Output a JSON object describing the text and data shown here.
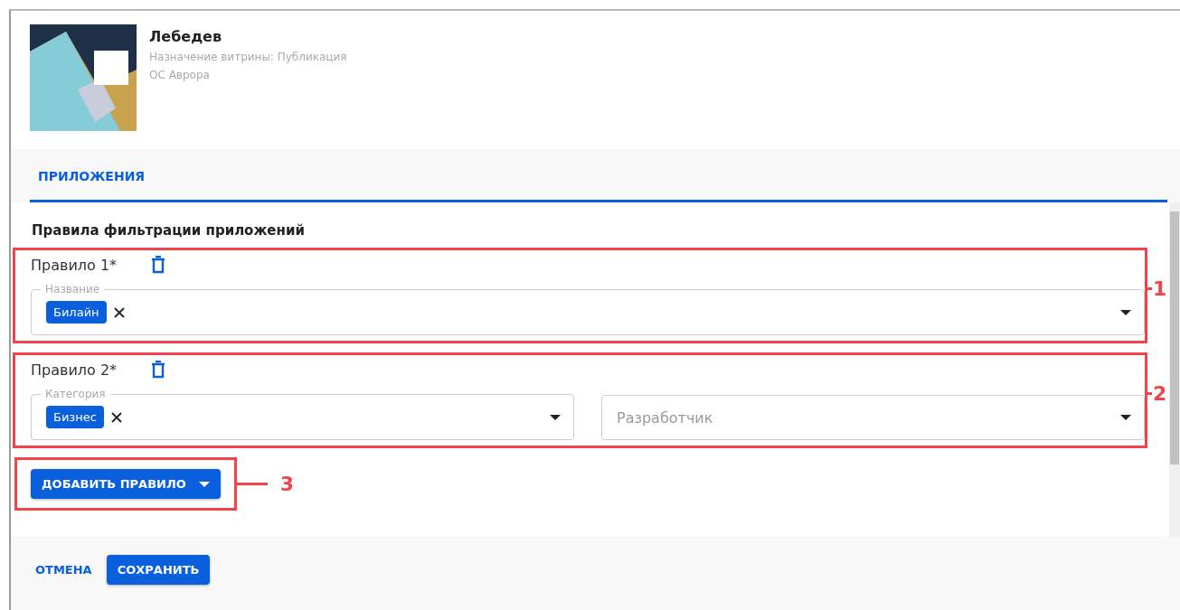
{
  "store": {
    "name": "Лебедев",
    "purpose": "Назначение витрины: Публикация",
    "os": "ОС Аврора"
  },
  "tabs": [
    {
      "label": "ПРИЛОЖЕНИЯ",
      "selected": true
    }
  ],
  "section_title": "Правила фильтрации приложений",
  "rules": [
    {
      "title": "Правило 1*",
      "callout": "1",
      "fields": [
        {
          "label": "Название",
          "chips": [
            "Билайн"
          ]
        }
      ]
    },
    {
      "title": "Правило 2*",
      "callout": "2",
      "fields": [
        {
          "label": "Категория",
          "chips": [
            "Бизнес"
          ]
        },
        {
          "placeholder": "Разработчик"
        }
      ]
    }
  ],
  "add_button": {
    "label": "ДОБАВИТЬ ПРАВИЛО",
    "callout": "3"
  },
  "footer": {
    "cancel": "ОТМЕНА",
    "save": "СОХРАНИТЬ"
  }
}
